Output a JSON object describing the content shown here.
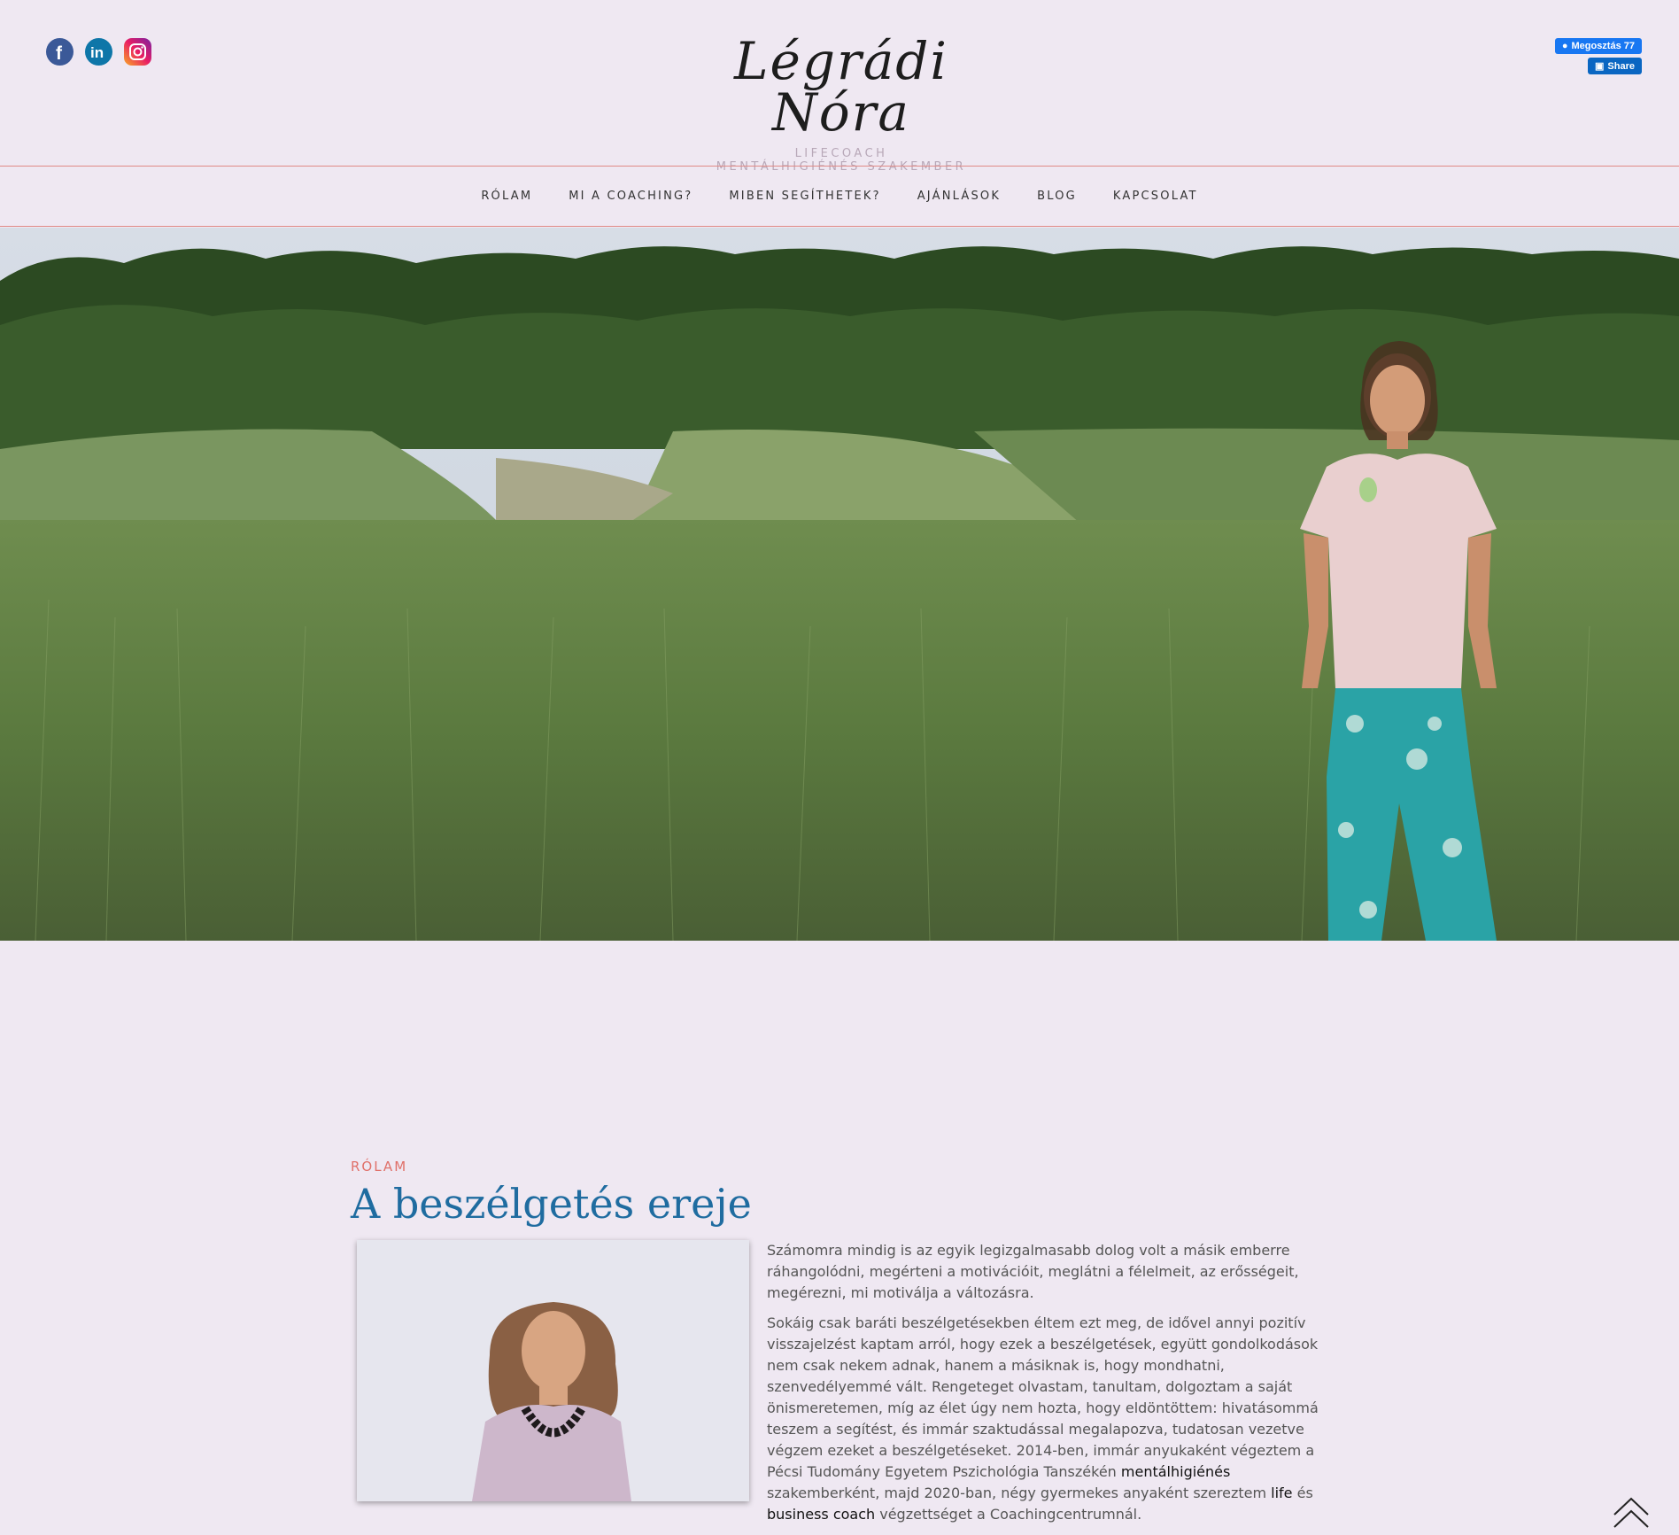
{
  "header": {
    "logo_script": "Légrádi Nóra",
    "logo_line1": "LIFECOACH",
    "logo_line2": "MENTÁLHIGIÉNÉS SZAKEMBER",
    "social": [
      "facebook-icon",
      "linkedin-icon",
      "instagram-icon"
    ],
    "fb_share_label": "Megosztás 77",
    "li_share_label": "Share"
  },
  "nav": {
    "items": [
      "RÓLAM",
      "MI A COACHING?",
      "MIBEN SEGÍTHETEK?",
      "AJÁNLÁSOK",
      "BLOG",
      "KAPCSOLAT"
    ]
  },
  "about": {
    "kicker": "RÓLAM",
    "title": "A beszélgetés ereje",
    "p1": "Számomra mindig is az egyik legizgalmasabb dolog volt a másik emberre ráhangolódni, megérteni a motivációit, meglátni a félelmeit, az erősségeit, megérezni, mi motiválja a változásra.",
    "p2_a": "Sokáig csak baráti beszélgetésekben éltem ezt meg, de idővel annyi pozitív visszajelzést kaptam arról, hogy ezek a beszélgetések, együtt gondolkodások nem csak nekem adnak, hanem a másiknak is, hogy mondhatni, szenvedélyemmé vált. Rengeteget olvastam, tanultam, dolgoztam a saját önismeretemen, míg az élet úgy nem hozta, hogy eldöntöttem: hivatásommá teszem a segítést, és immár szaktudással megalapozva, tudatosan vezetve végzem ezeket a beszélgetéseket. 2014-ben, immár anyukaként végeztem a Pécsi Tudomány Egyetem Pszichológia Tanszékén ",
    "p2_b": "mentálhigiénés",
    "p2_c": " szakemberként, majd 2020-ban, négy gyermekes anyaként szereztem ",
    "p2_d": "life",
    "p2_e": " és ",
    "p2_f": "business coach",
    "p2_g": " végzettséget a Coachingcentrumnál."
  },
  "colors": {
    "background": "#efe8f2",
    "accent": "#e0716a",
    "title": "#1f6ca0"
  }
}
